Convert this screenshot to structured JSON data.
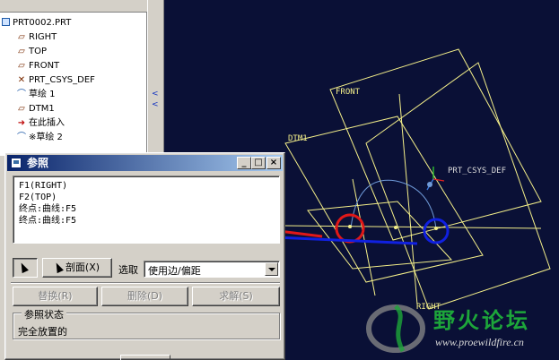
{
  "model_tree": {
    "root": "PRT0002.PRT",
    "items": [
      {
        "label": "RIGHT",
        "icon": "datum-plane-icon"
      },
      {
        "label": "TOP",
        "icon": "datum-plane-icon"
      },
      {
        "label": "FRONT",
        "icon": "datum-plane-icon"
      },
      {
        "label": "PRT_CSYS_DEF",
        "icon": "coordinate-system-icon"
      },
      {
        "label": "草绘 1",
        "icon": "sketch-icon"
      },
      {
        "label": "DTM1",
        "icon": "datum-plane-icon"
      },
      {
        "label": "在此插入",
        "icon": "insert-here-arrow-icon"
      },
      {
        "label": "※草绘 2",
        "icon": "sketch-icon"
      }
    ]
  },
  "viewport": {
    "labels": {
      "front": "FRONT",
      "dtm1": "DTM1",
      "csys": "PRT_CSYS_DEF",
      "right": "RIGHT"
    },
    "watermark": {
      "text": "野火论坛",
      "url": "www.proewildfire.cn"
    },
    "colors": {
      "background": "#0a1036",
      "datum": "#f5f08a",
      "sketch_arc": "#6f9ad8",
      "annotation_red": "#e01818",
      "annotation_blue": "#1020e0"
    }
  },
  "dialog": {
    "title": "参照",
    "caption_buttons": {
      "minimize": "_",
      "maximize": "□",
      "close": "×"
    },
    "references": [
      "F1(RIGHT)",
      "F2(TOP)",
      "终点:曲线:F5",
      "终点:曲线:F5"
    ],
    "section_button": "剖面(X)",
    "select_label": "选取",
    "select_value": "使用边/偏距",
    "buttons": {
      "replace": "替换(R)",
      "delete": "删除(D)",
      "solve": "求解(S)"
    },
    "status_title": "参照状态",
    "status_value": "完全放置的"
  }
}
